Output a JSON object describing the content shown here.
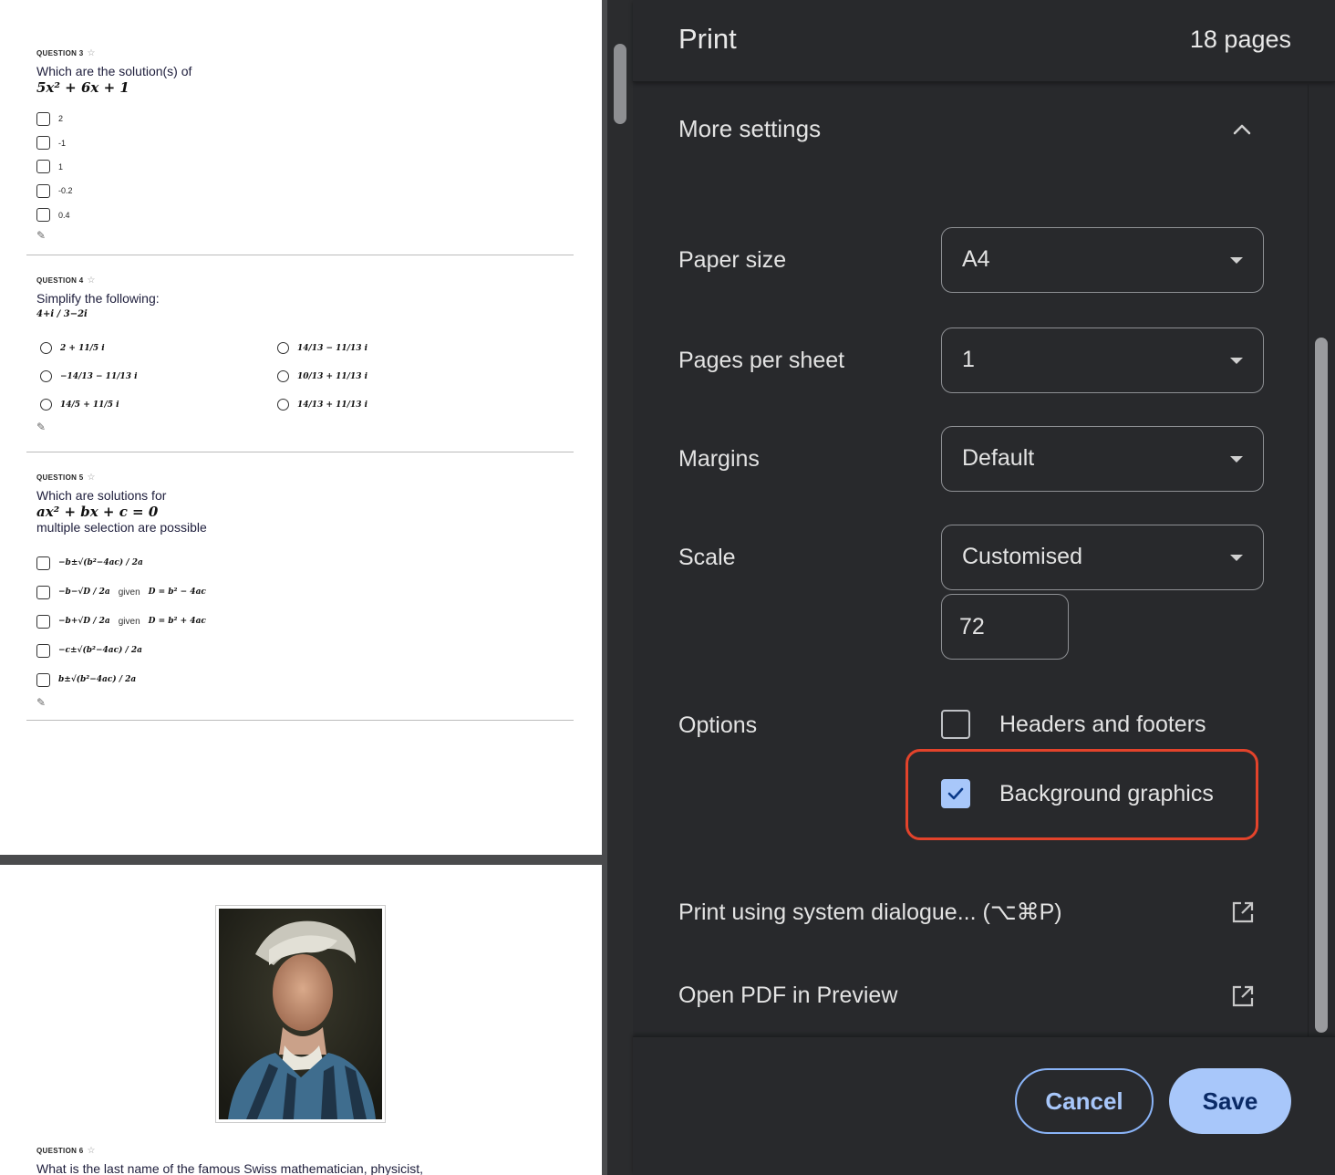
{
  "preview": {
    "q3": {
      "label": "QUESTION 3",
      "text": "Which are the solution(s) of",
      "math": "5x² + 6x + 1",
      "options": [
        "2",
        "-1",
        "1",
        "-0.2",
        "0.4"
      ]
    },
    "q4": {
      "label": "QUESTION 4",
      "text": "Simplify the following:",
      "math": "4+i / 3−2i",
      "options_left": [
        "2 + 11/5 i",
        "−14/13 − 11/13 i",
        "14/5 + 11/5 i"
      ],
      "options_right": [
        "14/13 − 11/13 i",
        "10/13 + 11/13 i",
        "14/13 + 11/13 i"
      ]
    },
    "q5": {
      "label": "QUESTION 5",
      "text": "Which are solutions for",
      "math": "ax² + bx + c = 0",
      "subtext": "multiple selection are possible",
      "options": [
        {
          "math": "−b±√(b²−4ac) / 2a",
          "given": "",
          "cond": ""
        },
        {
          "math": "−b−√D / 2a",
          "given": "given",
          "cond": "D = b² − 4ac"
        },
        {
          "math": "−b+√D / 2a",
          "given": "given",
          "cond": "D = b² + 4ac"
        },
        {
          "math": "−c±√(b²−4ac) / 2a",
          "given": "",
          "cond": ""
        },
        {
          "math": "b±√(b²−4ac) / 2a",
          "given": "",
          "cond": ""
        }
      ]
    },
    "q6": {
      "label": "QUESTION 6",
      "text": "What is the last name of the famous Swiss mathematician, physicist,"
    }
  },
  "panel": {
    "title": "Print",
    "page_count": "18 pages",
    "more_settings": "More settings",
    "paper_size": {
      "label": "Paper size",
      "value": "A4"
    },
    "pages_per_sheet": {
      "label": "Pages per sheet",
      "value": "1"
    },
    "margins": {
      "label": "Margins",
      "value": "Default"
    },
    "scale": {
      "label": "Scale",
      "value": "Customised",
      "custom_value": "72"
    },
    "options": {
      "label": "Options",
      "headers_footers": {
        "label": "Headers and footers",
        "checked": false
      },
      "background_graphics": {
        "label": "Background graphics",
        "checked": true
      }
    },
    "system_dialog": "Print using system dialogue... (⌥⌘P)",
    "open_pdf": "Open PDF in Preview",
    "cancel": "Cancel",
    "save": "Save"
  },
  "colors": {
    "panel_bg": "#28292c",
    "accent": "#a8c7fa",
    "highlight": "#e3432b"
  }
}
